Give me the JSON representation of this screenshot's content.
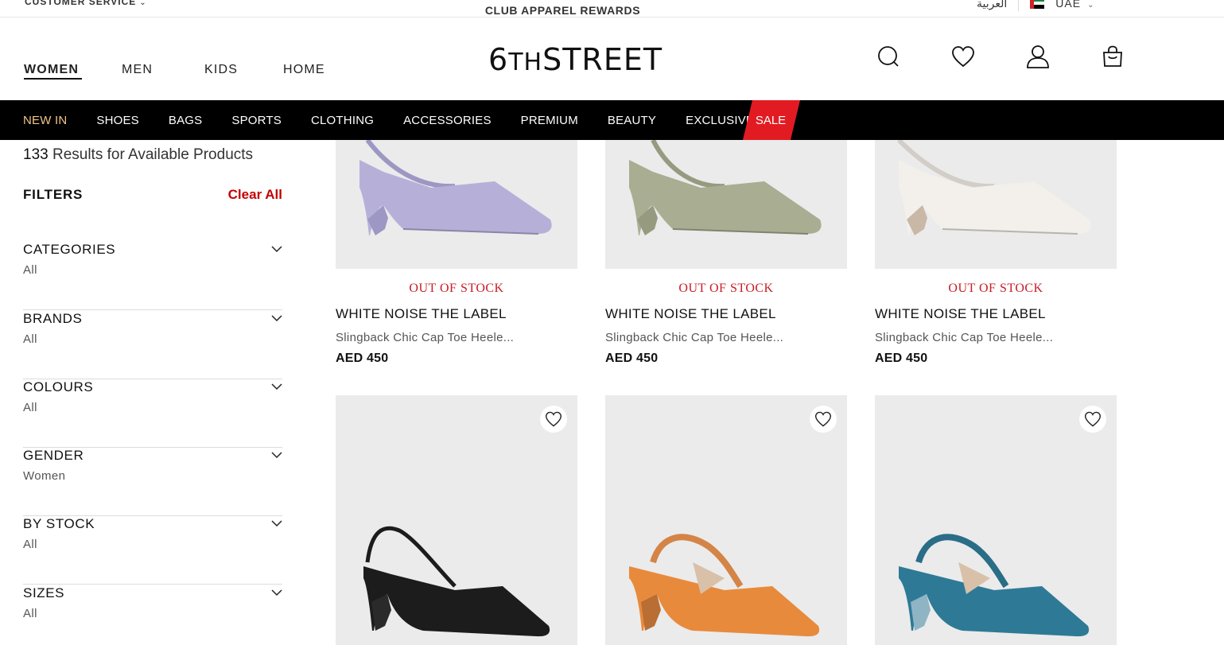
{
  "util_bar": {
    "customer_service": "CUSTOMER SERVICE",
    "rewards": "CLUB APPAREL REWARDS",
    "language": "العربية",
    "country": "UAE"
  },
  "header": {
    "genders": [
      "WOMEN",
      "MEN",
      "KIDS",
      "HOME"
    ],
    "active_gender": "WOMEN",
    "logo_main": "6",
    "logo_small": "TH",
    "logo_rest": "STREET",
    "icons": [
      "search-icon",
      "wishlist-heart-icon",
      "account-user-icon",
      "shopping-bag-icon"
    ]
  },
  "category_nav": {
    "items": [
      "NEW IN",
      "SHOES",
      "BAGS",
      "SPORTS",
      "CLOTHING",
      "ACCESSORIES",
      "PREMIUM",
      "BEAUTY",
      "EXCLUSIVE"
    ],
    "sale": "SALE",
    "colors": {
      "bar": "#000000",
      "newin": "#f2c48a",
      "sale": "#e21b23"
    }
  },
  "sidebar": {
    "result_count": "133",
    "result_text": " Results for Available Products",
    "filters_title": "FILTERS",
    "clear_all": "Clear All",
    "filters": [
      {
        "name": "CATEGORIES",
        "value": "All"
      },
      {
        "name": "BRANDS",
        "value": "All"
      },
      {
        "name": "COLOURS",
        "value": "All"
      },
      {
        "name": "GENDER",
        "value": "Women"
      },
      {
        "name": "BY STOCK",
        "value": "All"
      },
      {
        "name": "SIZES",
        "value": "All"
      }
    ]
  },
  "products": [
    {
      "stock": "OUT OF STOCK",
      "brand": "WHITE NOISE THE LABEL",
      "desc": "Slingback Chic Cap Toe Heele...",
      "price": "AED 450",
      "color": "#b6b0d9"
    },
    {
      "stock": "OUT OF STOCK",
      "brand": "WHITE NOISE THE LABEL",
      "desc": "Slingback Chic Cap Toe Heele...",
      "price": "AED 450",
      "color": "#a9ae93"
    },
    {
      "stock": "OUT OF STOCK",
      "brand": "WHITE NOISE THE LABEL",
      "desc": "Slingback Chic Cap Toe Heele...",
      "price": "AED 450",
      "color": "#e6e2dc"
    },
    {
      "color": "#1c1c1c"
    },
    {
      "color": "#e88a3c"
    },
    {
      "color": "#2e7a96"
    }
  ],
  "colors": {
    "accent_red": "#c40000",
    "oos_red": "#c81d25"
  }
}
